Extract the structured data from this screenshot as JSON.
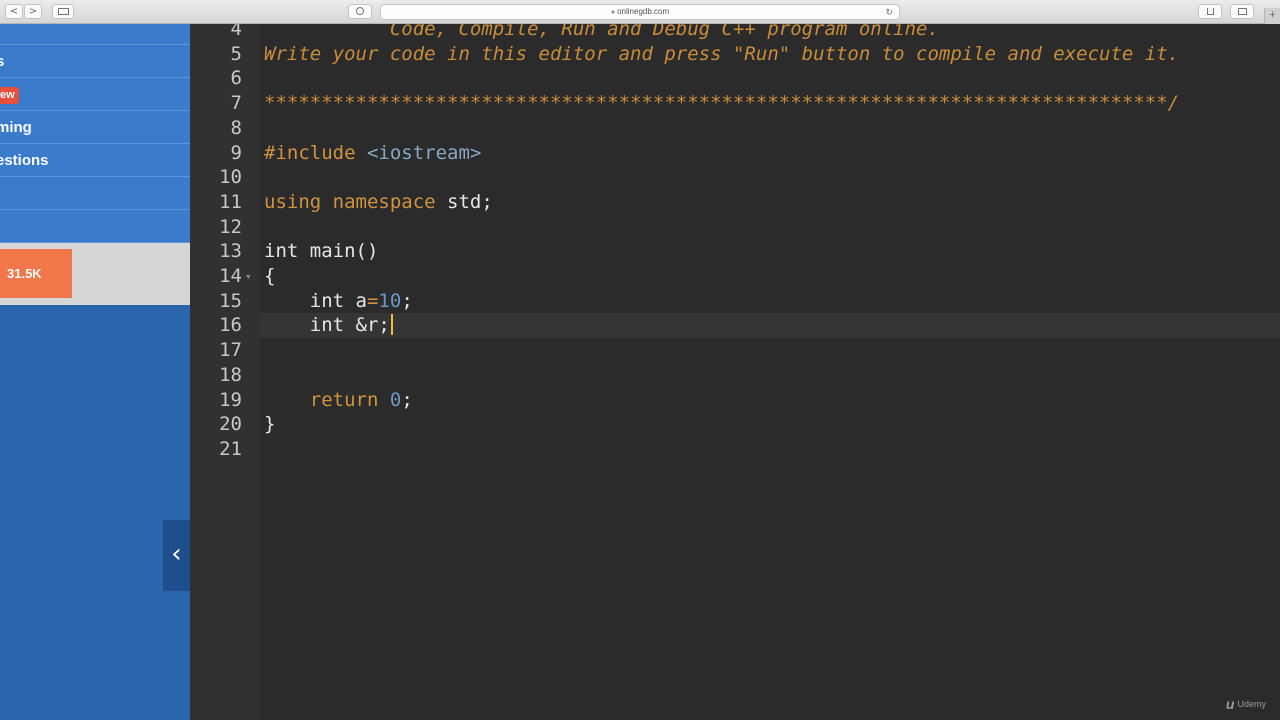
{
  "browser": {
    "url": "onlinegdb.com",
    "back_glyph": "<",
    "forward_glyph": ">",
    "reload_glyph": "↻",
    "newtab_glyph": "+"
  },
  "sidebar": {
    "items": [
      {
        "label": ""
      },
      {
        "label": "s"
      },
      {
        "label": "",
        "badge": "ew"
      },
      {
        "label": "ming"
      },
      {
        "label": "estions"
      },
      {
        "label": ""
      },
      {
        "label": ""
      }
    ],
    "share_count": "31.5K",
    "collapse_glyph": "‹"
  },
  "editor": {
    "lines": [
      {
        "n": "4",
        "text": "           Code, Compile, Run and Debug C++ program online.",
        "type": "comment"
      },
      {
        "n": "5",
        "text": "Write your code in this editor and press \"Run\" button to compile and execute it.",
        "type": "comment"
      },
      {
        "n": "6",
        "text": "",
        "type": "plain"
      },
      {
        "n": "7",
        "text": "*******************************************************************************/",
        "type": "comment"
      },
      {
        "n": "8",
        "text": "",
        "type": "plain"
      },
      {
        "n": "9",
        "pp": "#include ",
        "inc": "<iostream>",
        "type": "include"
      },
      {
        "n": "10",
        "text": "",
        "type": "plain"
      },
      {
        "n": "11",
        "kw": "using namespace",
        "rest": " std;",
        "type": "kwline"
      },
      {
        "n": "12",
        "text": "",
        "type": "plain"
      },
      {
        "n": "13",
        "text": "int main()",
        "type": "plain"
      },
      {
        "n": "14",
        "text": "{",
        "type": "plain",
        "fold": "▾"
      },
      {
        "n": "15",
        "pre": "    int ",
        "var": "a",
        "op": "=",
        "num": "10",
        "post": ";",
        "type": "assign"
      },
      {
        "n": "16",
        "text": "    int &r;",
        "type": "plain",
        "active": true
      },
      {
        "n": "17",
        "text": "",
        "type": "plain"
      },
      {
        "n": "18",
        "text": "",
        "type": "plain"
      },
      {
        "n": "19",
        "kwpre": "    ",
        "kw": "return",
        "mid": " ",
        "num": "0",
        "post": ";",
        "type": "return"
      },
      {
        "n": "20",
        "text": "}",
        "type": "plain"
      },
      {
        "n": "21",
        "text": "",
        "type": "plain"
      }
    ]
  },
  "watermark": {
    "logo": "u",
    "text": "Udemy"
  }
}
